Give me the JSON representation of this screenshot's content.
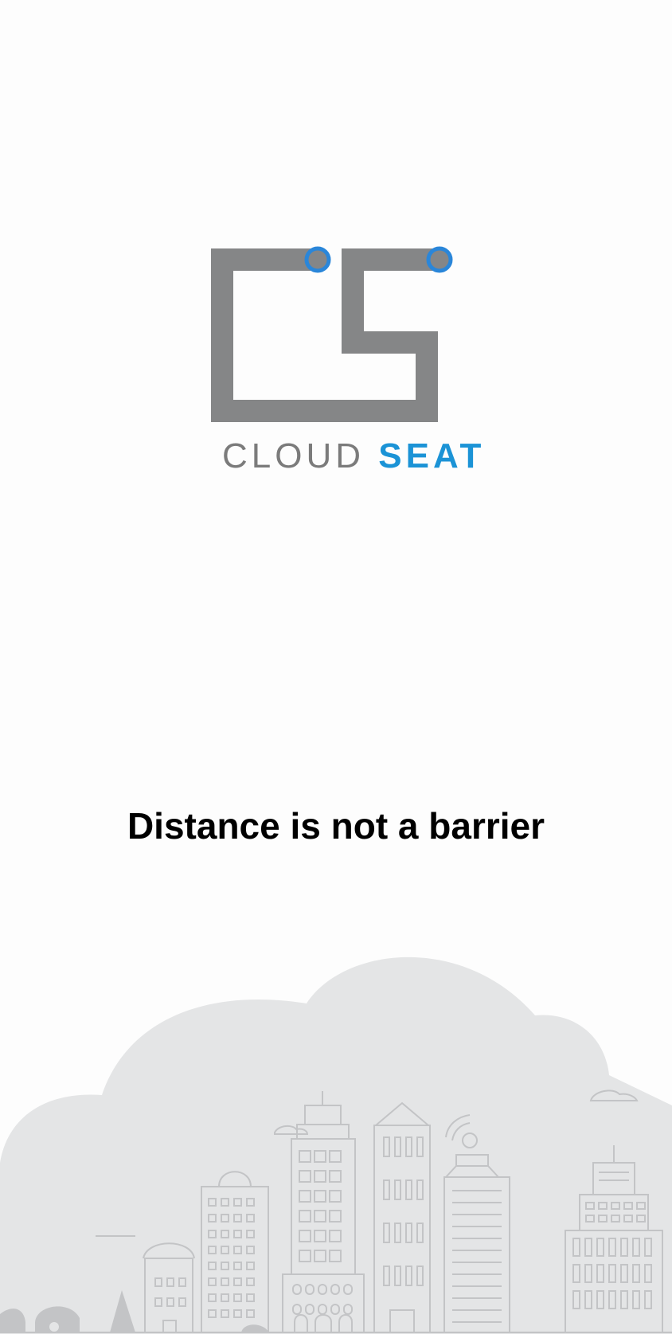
{
  "splash": {
    "brand": {
      "word1": "CLOUD",
      "word2": "SEAT",
      "word1_color": "#7b7b7b",
      "word2_color": "#1b93d6",
      "mark_color": "#858687",
      "accent_color": "#2a86d9"
    },
    "tagline": "Distance is not a barrier",
    "illustration": "city-skyline-cloud"
  }
}
